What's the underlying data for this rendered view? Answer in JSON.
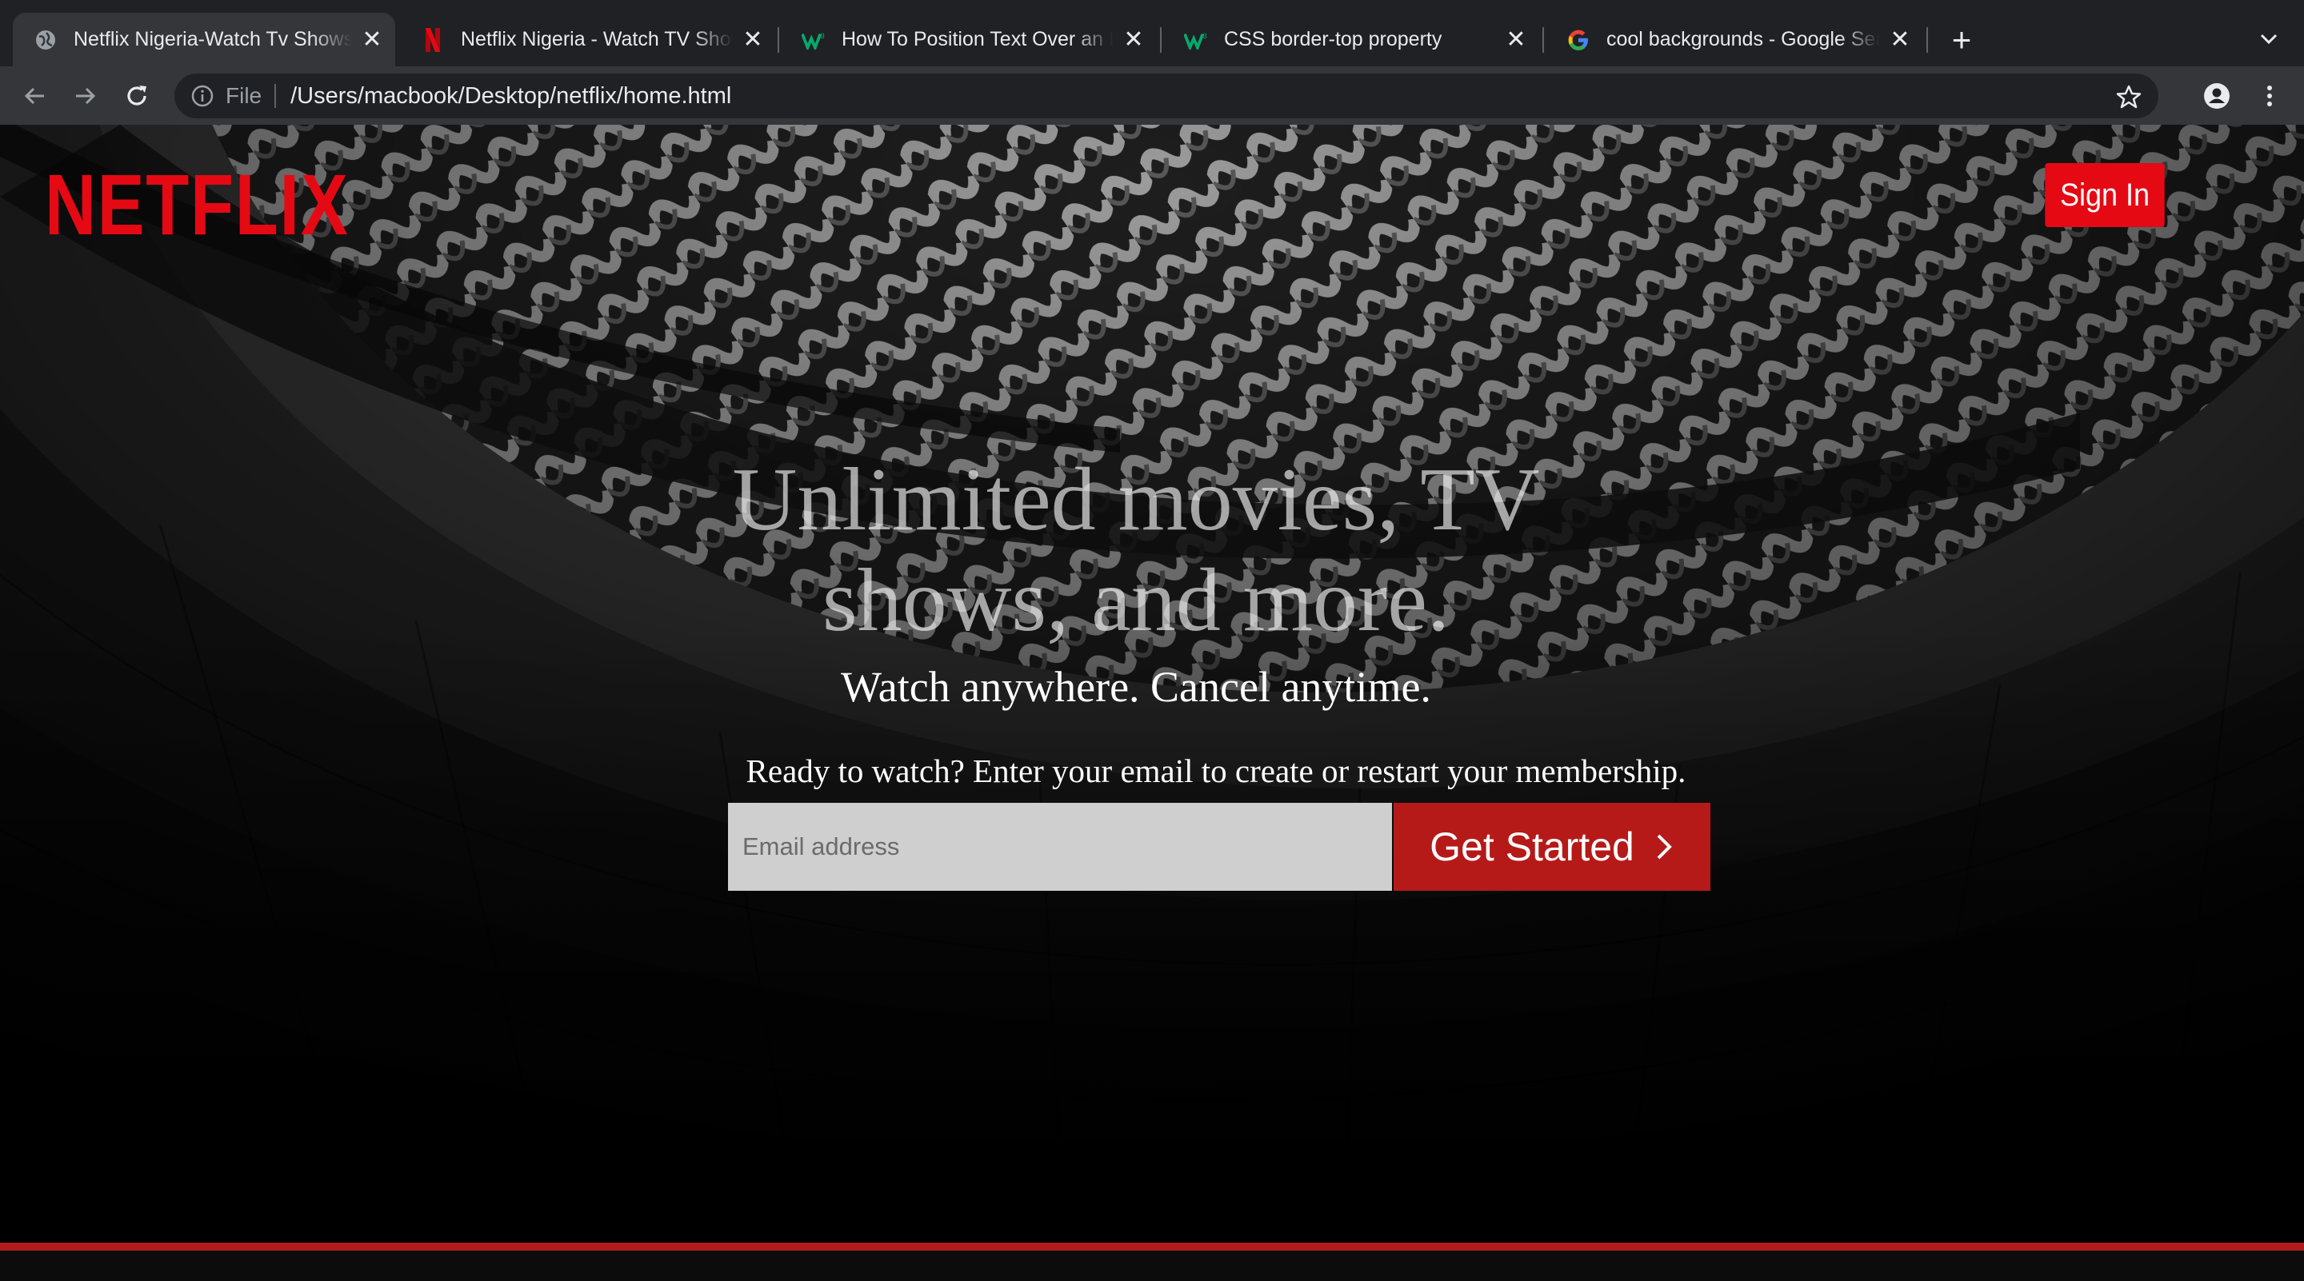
{
  "browser": {
    "tabs": [
      {
        "title": "Netflix Nigeria-Watch Tv Shows Online",
        "favicon": "globe-icon",
        "active": true
      },
      {
        "title": "Netflix Nigeria - Watch TV Shows Online",
        "favicon": "netflix-icon",
        "active": false
      },
      {
        "title": "How To Position Text Over an Image",
        "favicon": "w3schools-icon",
        "active": false
      },
      {
        "title": "CSS border-top property",
        "favicon": "w3schools-icon",
        "active": false
      },
      {
        "title": "cool backgrounds - Google Search",
        "favicon": "google-icon",
        "active": false
      }
    ],
    "omnibox": {
      "scheme": "File",
      "url": "/Users/macbook/Desktop/netflix/home.html"
    }
  },
  "page": {
    "logo": "NETFLIX",
    "signin_label": "Sign In",
    "hero": {
      "title": "Unlimited movies, TV shows, and more.",
      "subtitle": "Watch anywhere. Cancel anytime.",
      "cta_text": "Ready to watch? Enter your email to create or restart your membership."
    },
    "form": {
      "email_placeholder": "Email address",
      "button_label": "Get Started"
    }
  },
  "colors": {
    "brand_red": "#e50914",
    "button_red": "#b51a19",
    "tab_active": "#35363a",
    "tab_strip": "#202124"
  }
}
